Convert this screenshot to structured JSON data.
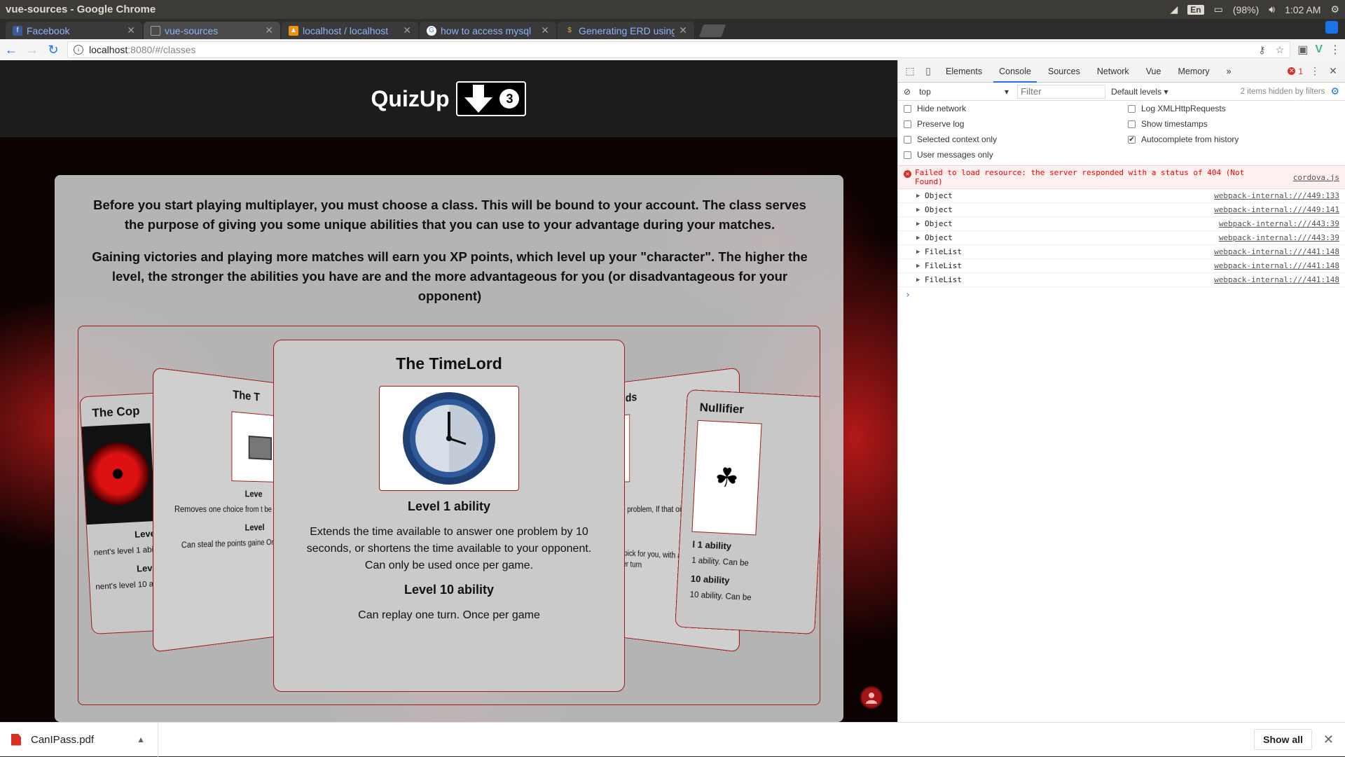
{
  "system": {
    "window_title": "vue-sources - Google Chrome",
    "lang": "En",
    "battery": "(98%)",
    "time": "1:02 AM"
  },
  "tabs": [
    {
      "label": "Facebook",
      "favicon": "facebook-icon",
      "color": "#3b5998"
    },
    {
      "label": "vue-sources",
      "favicon": "page-icon",
      "color": "#777777"
    },
    {
      "label": "localhost / localhost",
      "favicon": "phpmyadmin-icon",
      "color": "#f29111"
    },
    {
      "label": "how to access mysql",
      "favicon": "google-icon",
      "color": "#4285f4"
    },
    {
      "label": "Generating ERD using",
      "favicon": "dollar-icon",
      "color": "#000000"
    }
  ],
  "address": {
    "host": "localhost",
    "path": ":8080/#/classes"
  },
  "app": {
    "logo_text": "QuizUp",
    "logo_badge": "3",
    "intro_p1": "Before you start playing multiplayer, you must choose a class. This will be bound to your account. The class serves the purpose of giving you some unique abilities that you can use to your advantage during your matches.",
    "intro_p2": "Gaining victories and playing more matches will earn you XP points, which level up your \"character\". The higher the level, the stronger the abilities you have are and the more advantageous for you (or disadvantageous for your opponent)"
  },
  "cards": {
    "center": {
      "name": "The TimeLord",
      "lvl1_title": "Level 1 ability",
      "lvl1_desc": "Extends the time available to answer one problem by 10 seconds, or shortens the time available to your opponent. Can only be used once per game.",
      "lvl10_title": "Level 10 ability",
      "lvl10_desc": "Can replay one turn. Once per game"
    },
    "left1": {
      "name": "The T",
      "lvl1_title": "Leve",
      "lvl1_desc": "Removes one choice from t be used",
      "lvl10_title": "Level",
      "lvl10_desc": "Can steal the points gaine Once"
    },
    "left2": {
      "name": "The Cop",
      "lvl1_title": "Level 1 ab",
      "lvl1_desc": "nent's level 1 abil",
      "lvl10_title": "Level 10 a",
      "lvl10_desc": "nent's level 10 abi"
    },
    "right1": {
      "name": "of Odds",
      "lvl1_title": "bility",
      "lvl1_desc": "from the problem, If that oices. Once per turn",
      "lvl10_title": "bility",
      "lvl10_desc": "nerator pick for you, with an ight answer. Once per turn"
    },
    "right2": {
      "name": "Nullifier",
      "lvl1_title": "l 1 ability",
      "lvl1_desc": "1 ability. Can be",
      "lvl10_title": "10 ability",
      "lvl10_desc": "10 ability. Can be"
    }
  },
  "devtools": {
    "tabs": [
      "Elements",
      "Console",
      "Sources",
      "Network",
      "Vue",
      "Memory"
    ],
    "more": "»",
    "error_count": "1",
    "context": "top",
    "filter_placeholder": "Filter",
    "levels": "Default levels",
    "hidden_note": "2 items hidden by filters",
    "settings": [
      {
        "label": "Hide network",
        "checked": false
      },
      {
        "label": "Log XMLHttpRequests",
        "checked": false
      },
      {
        "label": "Preserve log",
        "checked": false
      },
      {
        "label": "Show timestamps",
        "checked": false
      },
      {
        "label": "Selected context only",
        "checked": false
      },
      {
        "label": "Autocomplete from history",
        "checked": true
      },
      {
        "label": "User messages only",
        "checked": false
      }
    ],
    "error": {
      "msg": "Failed to load resource: the server responded with a status of 404 (Not Found)",
      "src": "cordova.js"
    },
    "logs": [
      {
        "msg": "Object",
        "src": "webpack-internal:///449:133"
      },
      {
        "msg": "Object",
        "src": "webpack-internal:///449:141"
      },
      {
        "msg": "Object",
        "src": "webpack-internal:///443:39"
      },
      {
        "msg": "Object",
        "src": "webpack-internal:///443:39"
      },
      {
        "msg": "FileList",
        "src": "webpack-internal:///441:148"
      },
      {
        "msg": "FileList",
        "src": "webpack-internal:///441:148"
      },
      {
        "msg": "FileList",
        "src": "webpack-internal:///441:148"
      }
    ],
    "prompt": "›"
  },
  "downloads": {
    "file": "CanIPass.pdf",
    "show_all": "Show all"
  }
}
